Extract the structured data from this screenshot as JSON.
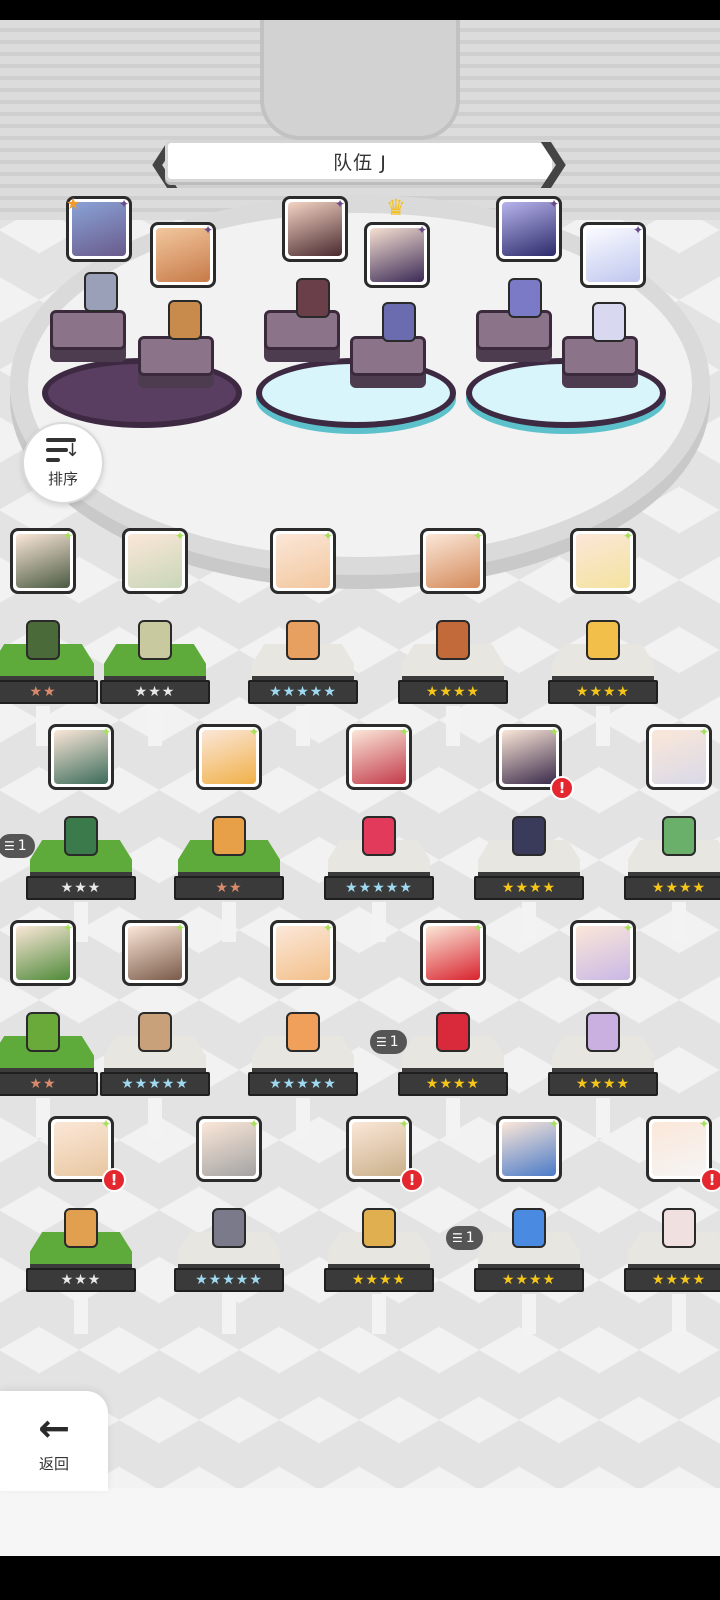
{
  "header": {
    "team_name": "队伍 J",
    "prev_glyph": "❮",
    "next_glyph": "❯"
  },
  "sort": {
    "label": "排序",
    "icon": "sort-list-icon"
  },
  "nav": {
    "back_label": "返回",
    "back_glyph": "←",
    "back_icon": "arrow-left-icon"
  },
  "glyphs": {
    "crown": "♛",
    "rank": "★",
    "alert": "!",
    "dup_stack": "☰"
  },
  "team_members": [
    {
      "slot": 1,
      "element": "dark",
      "leader": false
    },
    {
      "slot": 2,
      "element": "dark",
      "leader": false
    },
    {
      "slot": 3,
      "element": "dark",
      "leader": false
    },
    {
      "slot": 4,
      "element": "dark",
      "leader": true
    },
    {
      "slot": 5,
      "element": "dark",
      "leader": false
    },
    {
      "slot": 6,
      "element": "dark",
      "leader": false
    }
  ],
  "roster_rows": [
    [
      {
        "stars": "★★",
        "alert": false,
        "dup": ""
      },
      {
        "stars": "★★★",
        "alert": false,
        "dup": ""
      },
      {
        "stars": "★★★★★",
        "alert": false,
        "dup": ""
      },
      {
        "stars": "★★★★",
        "alert": false,
        "dup": ""
      },
      {
        "stars": "★★★★",
        "alert": false,
        "dup": ""
      }
    ],
    [
      {
        "stars": "★★★",
        "alert": false,
        "dup": "1"
      },
      {
        "stars": "★★",
        "alert": false,
        "dup": ""
      },
      {
        "stars": "★★★★★",
        "alert": false,
        "dup": ""
      },
      {
        "stars": "★★★★",
        "alert": true,
        "dup": ""
      },
      {
        "stars": "★★★★",
        "alert": false,
        "dup": ""
      }
    ],
    [
      {
        "stars": "★★",
        "alert": false,
        "dup": ""
      },
      {
        "stars": "★★★★★",
        "alert": false,
        "dup": ""
      },
      {
        "stars": "★★★★★",
        "alert": false,
        "dup": ""
      },
      {
        "stars": "★★★★",
        "alert": false,
        "dup": "1"
      },
      {
        "stars": "★★★★",
        "alert": false,
        "dup": ""
      }
    ],
    [
      {
        "stars": "★★★",
        "alert": true,
        "dup": ""
      },
      {
        "stars": "★★★★★",
        "alert": false,
        "dup": ""
      },
      {
        "stars": "★★★★",
        "alert": true,
        "dup": ""
      },
      {
        "stars": "★★★★",
        "alert": false,
        "dup": "1"
      },
      {
        "stars": "★★★★",
        "alert": true,
        "dup": ""
      }
    ]
  ],
  "colors": {
    "team_pad_dark": "#3d2942",
    "team_pad_light": "#d7f5fb",
    "star_gold": "#f5c518",
    "star_white": "#e8e8e8",
    "star_bronze": "#d98a6a",
    "star_rainbow": "#9fd9f0",
    "alert_red": "#e4262e",
    "crown_gold": "#f4c020"
  }
}
